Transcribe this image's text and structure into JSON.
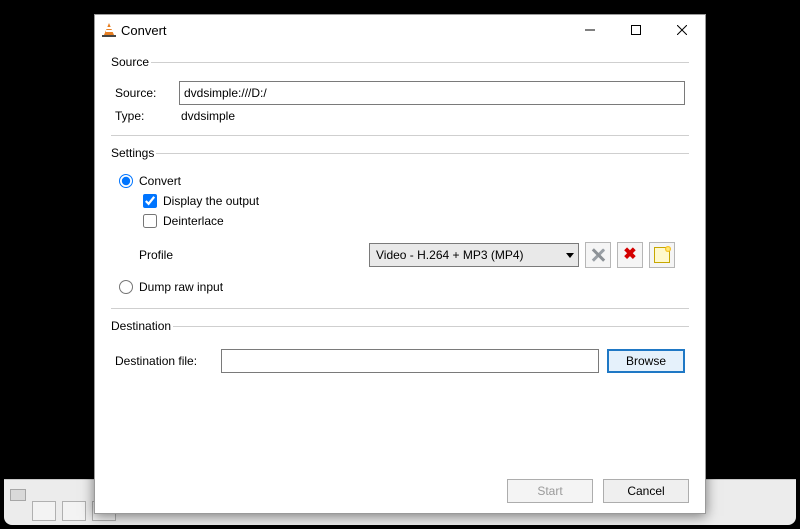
{
  "window": {
    "title": "Convert"
  },
  "source_group": {
    "legend": "Source",
    "source_label": "Source:",
    "source_value": "dvdsimple:///D:/",
    "type_label": "Type:",
    "type_value": "dvdsimple"
  },
  "settings_group": {
    "legend": "Settings",
    "convert_label": "Convert",
    "display_output_label": "Display the output",
    "deinterlace_label": "Deinterlace",
    "profile_label": "Profile",
    "profile_value": "Video - H.264 + MP3 (MP4)",
    "dump_raw_label": "Dump raw input"
  },
  "destination_group": {
    "legend": "Destination",
    "dest_label": "Destination file:",
    "dest_value": "",
    "browse_label": "Browse"
  },
  "footer": {
    "start_label": "Start",
    "cancel_label": "Cancel"
  }
}
